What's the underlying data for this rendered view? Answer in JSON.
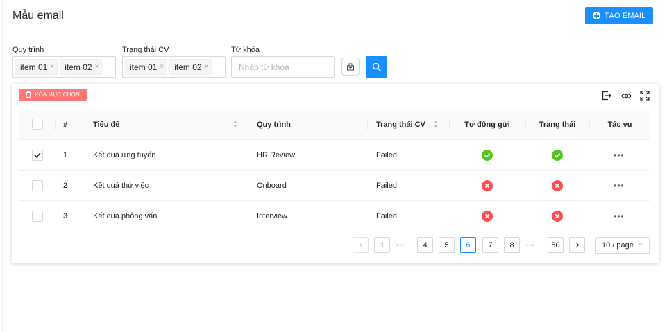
{
  "header": {
    "title": "Mẫu email",
    "create_label": "TẠO EMAIL"
  },
  "filters": {
    "process_label": "Quy trình",
    "process_tags": [
      "item 01",
      "item 02"
    ],
    "status_label": "Trạng thái CV",
    "status_tags": [
      "item 01",
      "item 02"
    ],
    "keyword_label": "Từ khóa",
    "keyword_placeholder": "Nhập từ khóa",
    "tag_remove_glyph": "×"
  },
  "toolbar": {
    "delete_label": "XÓA MỤC CHỌN"
  },
  "table": {
    "columns": [
      "#",
      "Tiêu đề",
      "Quy trình",
      "Trạng thái CV",
      "Tự động gửi",
      "Trạng thái",
      "Tác vụ"
    ],
    "rows": [
      {
        "checked": true,
        "index": "1",
        "title": "Kết quả ứng tuyển",
        "process": "HR Review",
        "cv_status": "Failed",
        "auto_send": "success",
        "status": "success",
        "actions": "•••"
      },
      {
        "checked": false,
        "index": "2",
        "title": "Kết quả thử việc",
        "process": "Onboard",
        "cv_status": "Failed",
        "auto_send": "error",
        "status": "error",
        "actions": "•••"
      },
      {
        "checked": false,
        "index": "3",
        "title": "Kết quả phỏng vấn",
        "process": "Interview",
        "cv_status": "Failed",
        "auto_send": "error",
        "status": "error",
        "actions": "•••"
      }
    ]
  },
  "pagination": {
    "pages": [
      "1",
      "4",
      "5",
      "6",
      "7",
      "8",
      "50"
    ],
    "current": "6",
    "ellipsis": "•••",
    "page_size": "10 / page"
  },
  "colors": {
    "primary": "#1890ff",
    "danger": "#ff4d4f",
    "delete_bg": "#ff7875",
    "success": "#52c41a"
  }
}
